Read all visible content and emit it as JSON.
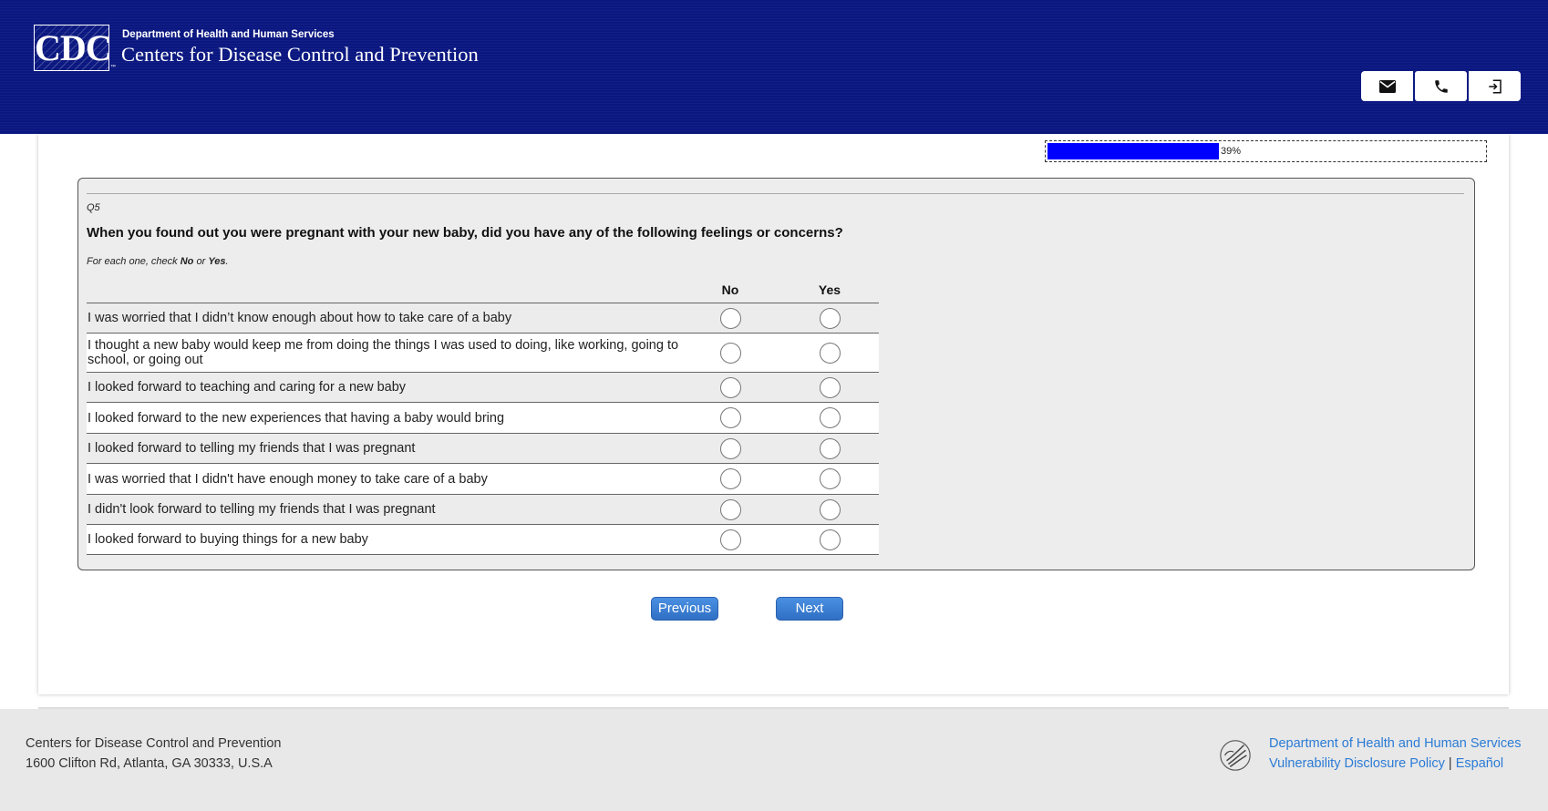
{
  "header": {
    "logo_text": "CDC",
    "logo_tm": "™",
    "department": "Department of Health and Human Services",
    "agency": "Centers for Disease Control and Prevention",
    "buttons": [
      "mail-icon",
      "phone-icon",
      "exit-icon"
    ]
  },
  "progress": {
    "value": 0.39,
    "label": "39%"
  },
  "question": {
    "number": "Q5",
    "text": "When you found out you were pregnant with your new baby, did you have any of the following feelings or concerns?",
    "instruction_prefix": "For each one, check ",
    "instruction_no": "No",
    "instruction_mid": " or ",
    "instruction_yes": "Yes",
    "instruction_suffix": ".",
    "columns": [
      "No",
      "Yes"
    ],
    "items": [
      "I was worried that I didn’t know enough about how to take care of a baby",
      "I thought a new baby would keep me from doing the things I was used to doing, like working, going to school, or going out",
      "I looked forward to teaching and caring for a new baby",
      "I looked forward to the new experiences that having a baby would bring",
      "I looked forward to telling my friends that I was pregnant",
      "I was worried that I didn't have enough money to take care of a baby",
      "I didn't look forward to telling my friends that I was pregnant",
      "I looked forward to buying things for a new baby"
    ]
  },
  "nav": {
    "previous": "Previous",
    "next": "Next"
  },
  "footer": {
    "org": "Centers for Disease Control and Prevention",
    "address": "1600 Clifton Rd, Atlanta, GA 30333, U.S.A",
    "hhs_link": "Department of Health and Human Services",
    "vdp_link": "Vulnerability Disclosure Policy",
    "separator": "|",
    "espanol_link": "Español"
  },
  "colors": {
    "header_bg": "#0a1780",
    "progress_fill": "#0000ff",
    "link": "#2b7bd6",
    "button": "#3d80d6"
  }
}
